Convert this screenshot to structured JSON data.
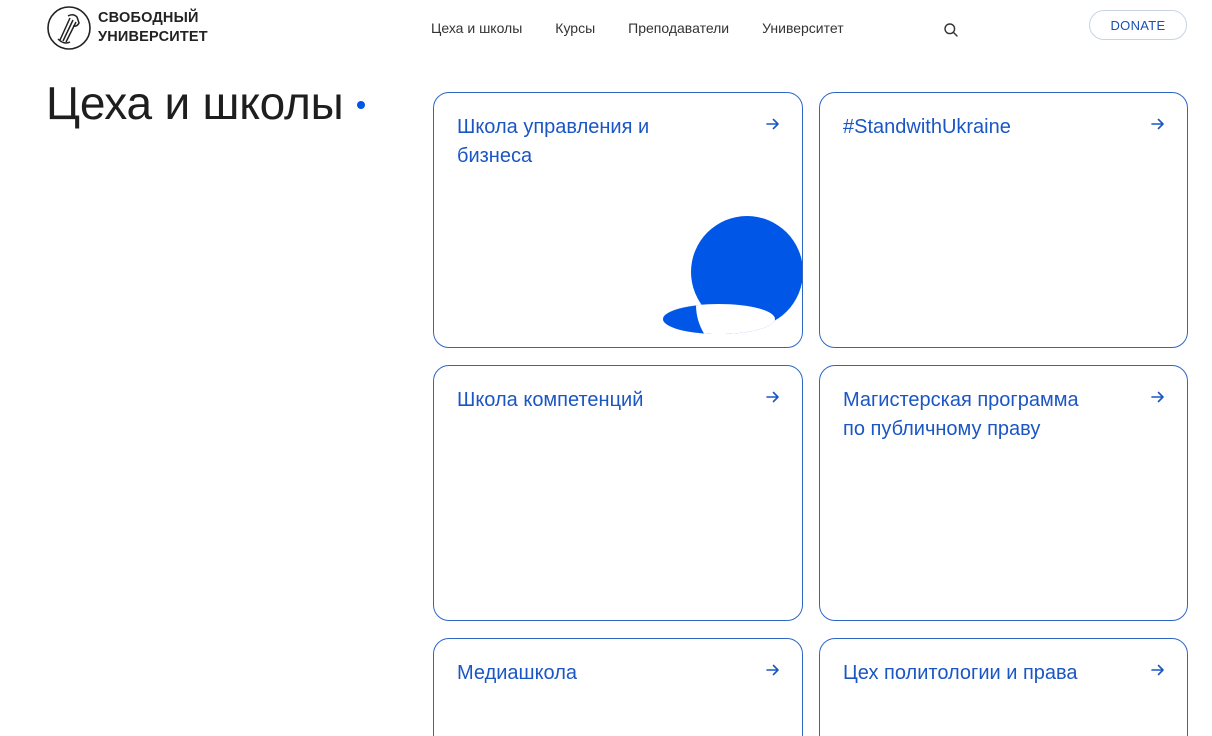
{
  "header": {
    "logo": {
      "line1": "СВОБОДНЫЙ",
      "line2": "УНИВЕРСИТЕТ",
      "icon": "raised-fist-logo"
    },
    "nav": [
      {
        "label": "Цеха и школы"
      },
      {
        "label": "Курсы"
      },
      {
        "label": "Преподаватели"
      },
      {
        "label": "Университет"
      }
    ],
    "search_icon": "search-icon",
    "donate_label": "DONATE"
  },
  "page": {
    "title": "Цеха и школы"
  },
  "cards": [
    {
      "title": "Школа управления и бизнеса"
    },
    {
      "title": "#StandwithUkraine"
    },
    {
      "title": "Школа компетенций"
    },
    {
      "title": "Магистерская программа по публичному праву"
    },
    {
      "title": "Медиашкола"
    },
    {
      "title": "Цех политологии и права"
    }
  ],
  "colors": {
    "accent": "#0057e7",
    "card_border": "#2f66c6",
    "card_text": "#1a56c4",
    "donate_text": "#1a4fb3"
  }
}
